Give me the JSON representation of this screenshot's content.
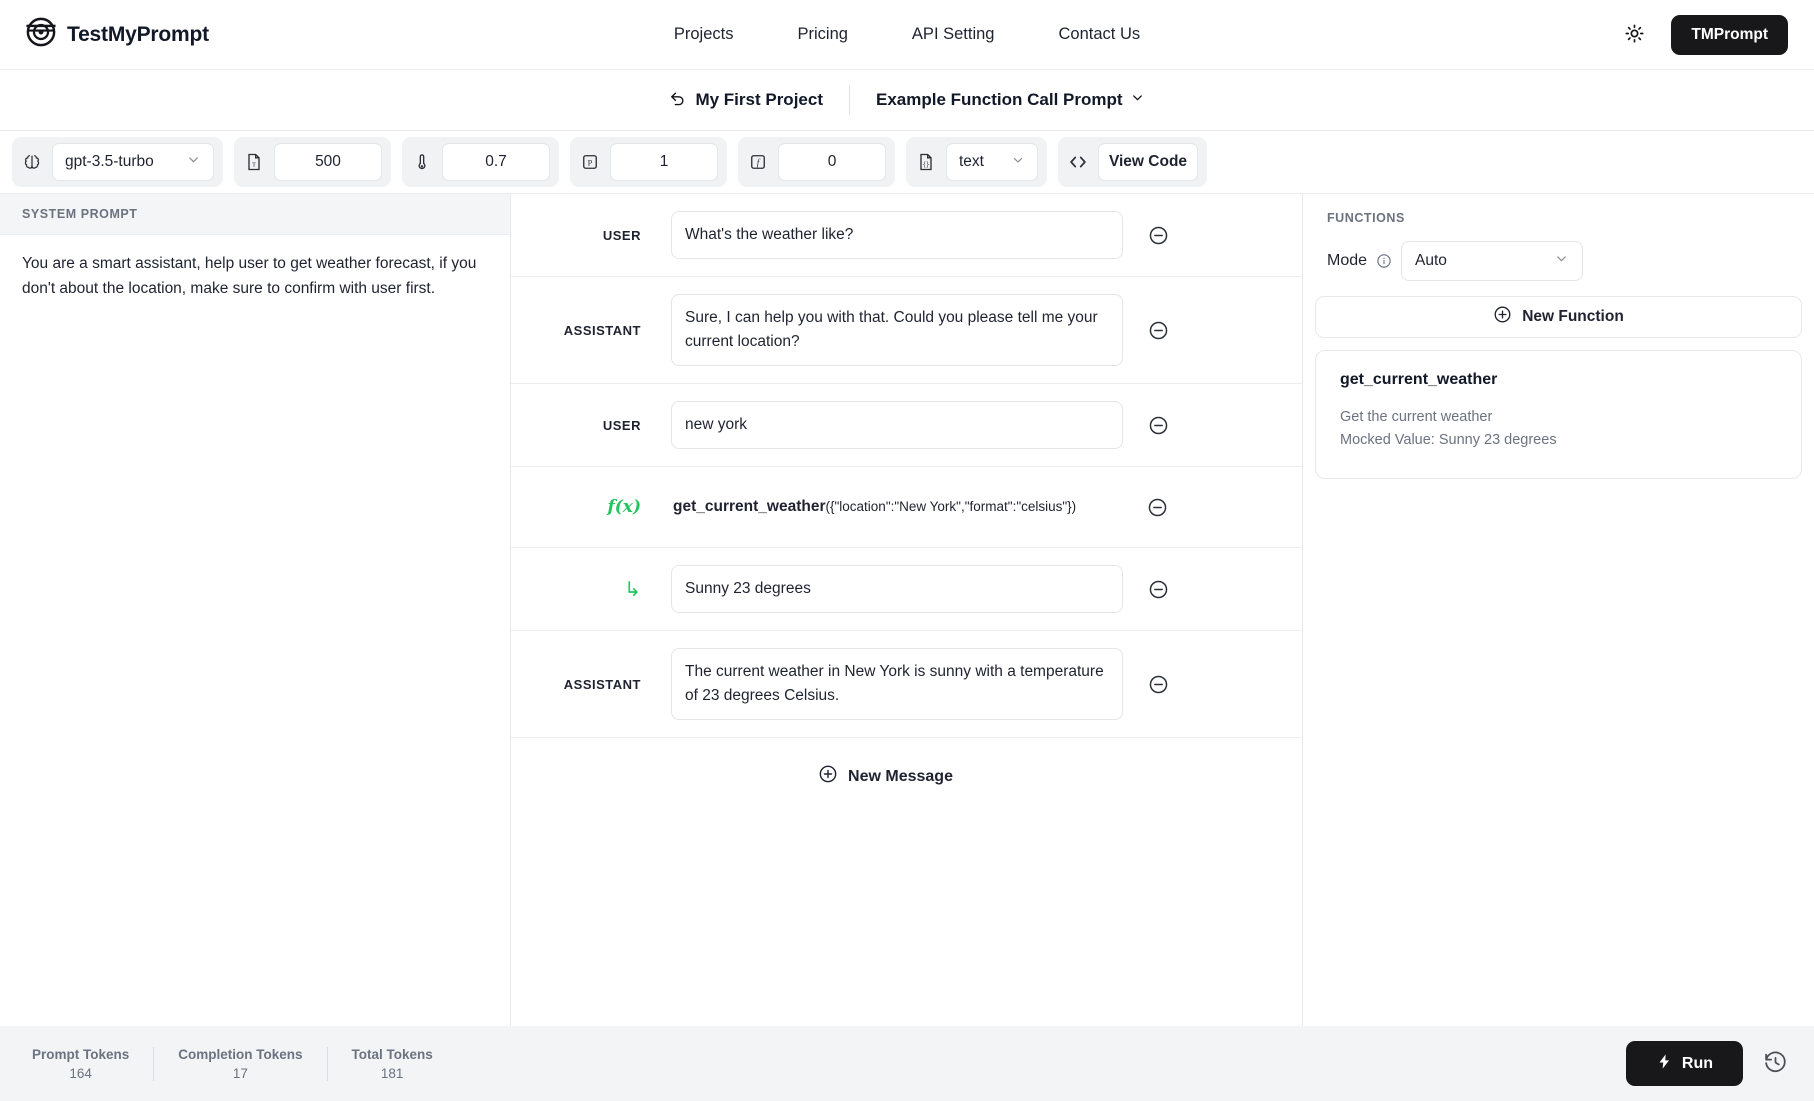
{
  "brand": {
    "name": "TestMyPrompt",
    "logo_icon": "bullseye-target-icon"
  },
  "nav": {
    "items": [
      {
        "label": "Projects"
      },
      {
        "label": "Pricing"
      },
      {
        "label": "API Setting"
      },
      {
        "label": "Contact Us"
      }
    ],
    "theme_toggle_icon": "sun-icon",
    "user_button": "TMPrompt"
  },
  "project_bar": {
    "back_icon": "undo-arrow-icon",
    "project_title": "My First Project",
    "prompt_title": "Example Function Call Prompt",
    "prompt_chevron_icon": "chevron-down-icon"
  },
  "toolbar": {
    "model": {
      "icon": "brain-icon",
      "value": "gpt-3.5-turbo"
    },
    "max_tokens": {
      "icon": "text-document-icon",
      "value": "500"
    },
    "temperature": {
      "icon": "thermometer-icon",
      "value": "0.7"
    },
    "top_p": {
      "icon": "p-box-icon",
      "value": "1"
    },
    "frequency_penalty": {
      "icon": "f-box-icon",
      "value": "0"
    },
    "response_format": {
      "icon": "json-document-icon",
      "value": "text"
    },
    "view_code": {
      "icon": "code-brackets-icon",
      "label": "View Code"
    }
  },
  "system_prompt": {
    "heading": "SYSTEM PROMPT",
    "text": "You are a smart assistant, help user to get weather forecast, if you don't about the location, make sure to confirm with user first."
  },
  "messages": [
    {
      "role": "USER",
      "kind": "text",
      "content": "What's the weather like?"
    },
    {
      "role": "ASSISTANT",
      "kind": "text",
      "content": "Sure, I can help you with that. Could you please tell me your current location?"
    },
    {
      "role": "USER",
      "kind": "text",
      "content": "new york"
    },
    {
      "role": "f(x)",
      "kind": "function_call",
      "name": "get_current_weather",
      "args": "({\"location\":\"New York\",\"format\":\"celsius\"})"
    },
    {
      "role": "↳",
      "kind": "function_return",
      "content": "Sunny 23 degrees"
    },
    {
      "role": "ASSISTANT",
      "kind": "text",
      "content": "The current weather in New York is sunny with a temperature of 23 degrees Celsius."
    }
  ],
  "new_message": {
    "icon": "plus-circle-icon",
    "label": "New Message"
  },
  "remove_icon": "minus-circle-icon",
  "functions_panel": {
    "heading": "FUNCTIONS",
    "mode_label": "Mode",
    "mode_info_icon": "info-circle-icon",
    "mode_value": "Auto",
    "new_function": {
      "icon": "plus-circle-icon",
      "label": "New Function"
    },
    "cards": [
      {
        "name": "get_current_weather",
        "description": "Get the current weather",
        "mocked_value": "Mocked Value: Sunny 23 degrees"
      }
    ]
  },
  "footer": {
    "tokens": [
      {
        "label": "Prompt Tokens",
        "value": "164"
      },
      {
        "label": "Completion Tokens",
        "value": "17"
      },
      {
        "label": "Total Tokens",
        "value": "181"
      }
    ],
    "run_button": {
      "icon": "lightning-bolt-icon",
      "label": "Run"
    },
    "history_icon": "history-clock-icon"
  },
  "colors": {
    "accent_green": "#22c55e",
    "dark_button": "#18181b",
    "muted_text": "#6b7280"
  }
}
